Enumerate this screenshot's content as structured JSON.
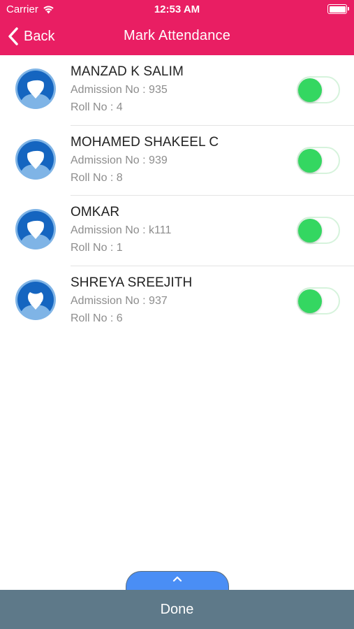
{
  "status_bar": {
    "carrier": "Carrier",
    "time": "12:53 AM",
    "wifi_icon": "wifi-icon",
    "battery_icon": "battery-full-icon"
  },
  "header": {
    "back_label": "Back",
    "back_icon": "chevron-left-icon",
    "title": "Mark Attendance",
    "color": "#e91e63"
  },
  "students": [
    {
      "name": "MANZAD K SALIM",
      "admission": "Admission No : 935",
      "roll": "Roll No : 4",
      "avatar": "boy-avatar-icon",
      "present": true
    },
    {
      "name": "MOHAMED SHAKEEL C",
      "admission": "Admission No : 939",
      "roll": "Roll No : 8",
      "avatar": "boy-avatar-icon",
      "present": true
    },
    {
      "name": "OMKAR",
      "admission": "Admission No : k111",
      "roll": "Roll No : 1",
      "avatar": "boy-avatar-icon",
      "present": true
    },
    {
      "name": "SHREYA SREEJITH",
      "admission": "Admission No : 937",
      "roll": "Roll No : 6",
      "avatar": "girl-avatar-icon",
      "present": true
    }
  ],
  "footer": {
    "pull_tab_icon": "chevron-up-icon",
    "done_label": "Done",
    "done_color": "#5e7989",
    "tab_color": "#4a8ef5"
  },
  "colors": {
    "toggle_on": "#34d761",
    "avatar_blue": "#1565c0"
  }
}
